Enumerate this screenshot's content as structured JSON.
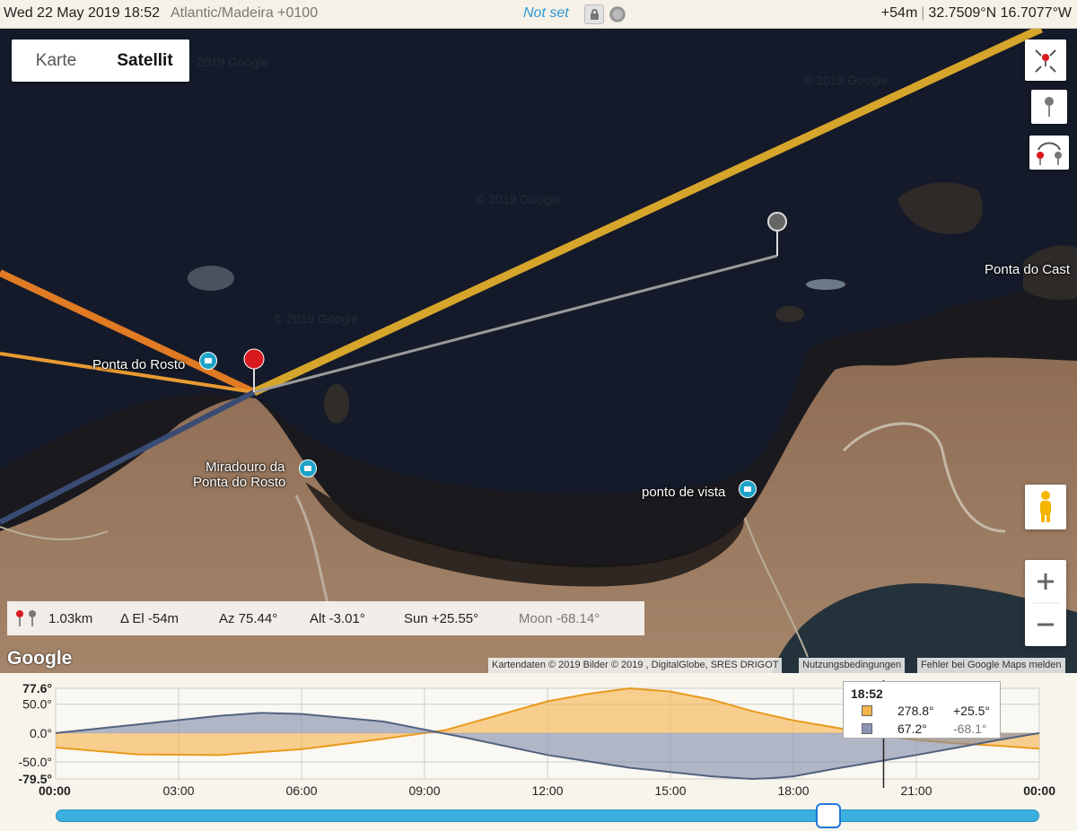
{
  "topbar": {
    "datetime": "Wed 22 May 2019 18:52",
    "timezone": "Atlantic/Madeira +0100",
    "status": "Not set",
    "elevation": "+54m",
    "coordinates": "32.7509°N 16.7077°W"
  },
  "map": {
    "type_controls": {
      "karte": "Karte",
      "satellit": "Satellit"
    },
    "places": {
      "ponta_do_rosto": "Ponta do Rosto",
      "miradouro_1": "Miradouro da",
      "miradouro_2": "Ponta do Rosto",
      "ponto_de_vista": "ponto de vista",
      "ponta_do_castelo": "Ponta do Cast"
    },
    "watermark": "© 2019 Google",
    "info": {
      "distance": "1.03km",
      "delta_el": "Δ El  -54m",
      "azimuth": "Az 75.44°",
      "altitude": "Alt  -3.01°",
      "sun": "Sun +25.55°",
      "moon": "Moon -68.14°"
    },
    "google_logo": "Google",
    "attribution": {
      "data": "Kartendaten © 2019 Bilder © 2019 , DigitalGlobe, SRES DRIGOT",
      "terms": "Nutzungsbedingungen",
      "report": "Fehler bei Google Maps melden"
    },
    "colors": {
      "sun_line": "#d6a52b",
      "moon_line": "#3a4c74",
      "sunset_line": "#e07a24",
      "sunrise_line": "#e99a30"
    }
  },
  "chart_data": {
    "type": "area",
    "x_ticks": [
      "00:00",
      "03:00",
      "06:00",
      "09:00",
      "12:00",
      "15:00",
      "18:00",
      "21:00",
      "00:00"
    ],
    "y_ticks": [
      "77.6°",
      "50.0°",
      "0.0°",
      "-50.0°",
      "-79.5°"
    ],
    "ylim": [
      -79.5,
      77.6
    ],
    "xlim": [
      0,
      24
    ],
    "cursor_time_hours": 20.2,
    "series": [
      {
        "color": "#f5b34a",
        "x": [
          0,
          2,
          4,
          6,
          8,
          9.5,
          11,
          12,
          13,
          14,
          15,
          16,
          17,
          18,
          19,
          20,
          21,
          22,
          23,
          24
        ],
        "values": [
          -25,
          -37,
          -38,
          -28,
          -10,
          5,
          35,
          55,
          68,
          77.6,
          72,
          58,
          38,
          22,
          10,
          -3,
          -12,
          -18,
          -22,
          -27
        ]
      },
      {
        "color": "#7e8aa8",
        "x": [
          0,
          2,
          4,
          5,
          6,
          8,
          10,
          12,
          14,
          16,
          17,
          17.5,
          18,
          19,
          20,
          21,
          22,
          23,
          24
        ],
        "values": [
          0,
          15,
          30,
          35,
          33,
          20,
          -8,
          -38,
          -60,
          -75,
          -79.5,
          -78,
          -75,
          -62,
          -50,
          -38,
          -25,
          -12,
          0
        ]
      }
    ],
    "legend": {
      "time": "18:52",
      "rows": [
        {
          "color": "#f5b34a",
          "azimuth": "278.8°",
          "altitude": "+25.5°"
        },
        {
          "color": "#8a96b3",
          "azimuth": "67.2°",
          "altitude": "-68.1°"
        }
      ]
    }
  }
}
